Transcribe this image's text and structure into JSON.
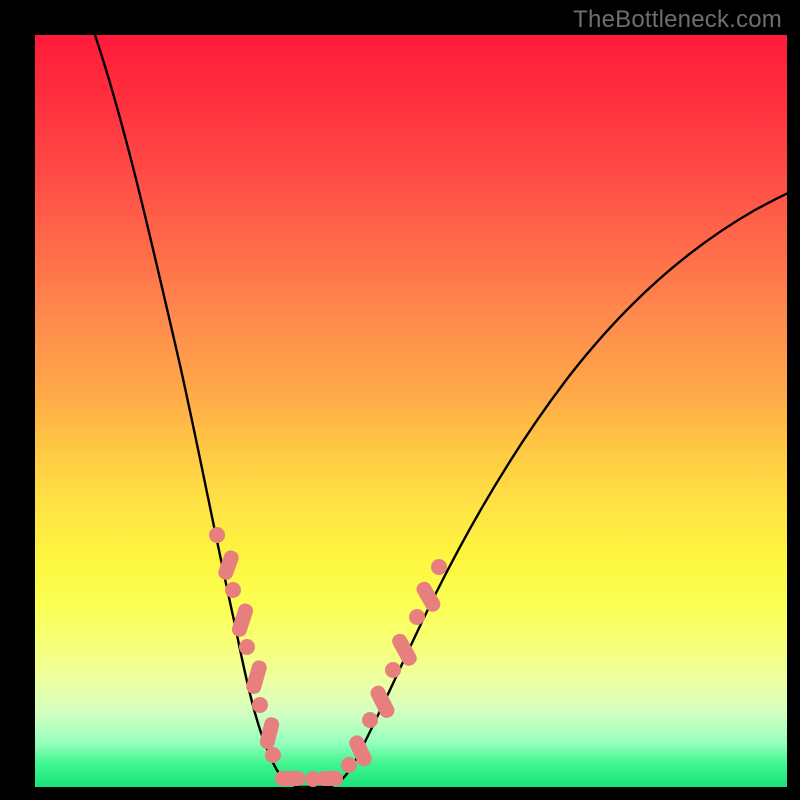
{
  "watermark": {
    "text": "TheBottleneck.com"
  },
  "chart_data": {
    "type": "line",
    "title": "",
    "xlabel": "",
    "ylabel": "",
    "xlim": [
      0,
      100
    ],
    "ylim": [
      0,
      100
    ],
    "series": [
      {
        "name": "bottleneck-curve",
        "x": [
          8,
          10,
          12,
          14,
          16,
          18,
          20,
          22,
          24,
          26,
          27,
          28,
          29,
          30,
          31,
          32,
          33,
          35,
          37,
          40,
          45,
          50,
          55,
          60,
          65,
          70,
          75,
          80,
          85,
          90,
          95,
          100
        ],
        "values": [
          100,
          92,
          83,
          74,
          65,
          55,
          46,
          37,
          28,
          19,
          14,
          9,
          5,
          2,
          0,
          0,
          2,
          6,
          11,
          18,
          28,
          36,
          43,
          49,
          54,
          58,
          62,
          65,
          68,
          70,
          72,
          74
        ]
      }
    ],
    "overlay": {
      "name": "marker-band",
      "x": [
        22,
        23.5,
        24.5,
        25.5,
        26.5,
        27.5,
        28.5,
        30,
        32,
        33.5,
        35,
        36.5,
        38,
        40,
        41.5
      ],
      "values": [
        37,
        31,
        27,
        22,
        17,
        12,
        7,
        2,
        2,
        6,
        10,
        14,
        18,
        23,
        27
      ]
    }
  }
}
